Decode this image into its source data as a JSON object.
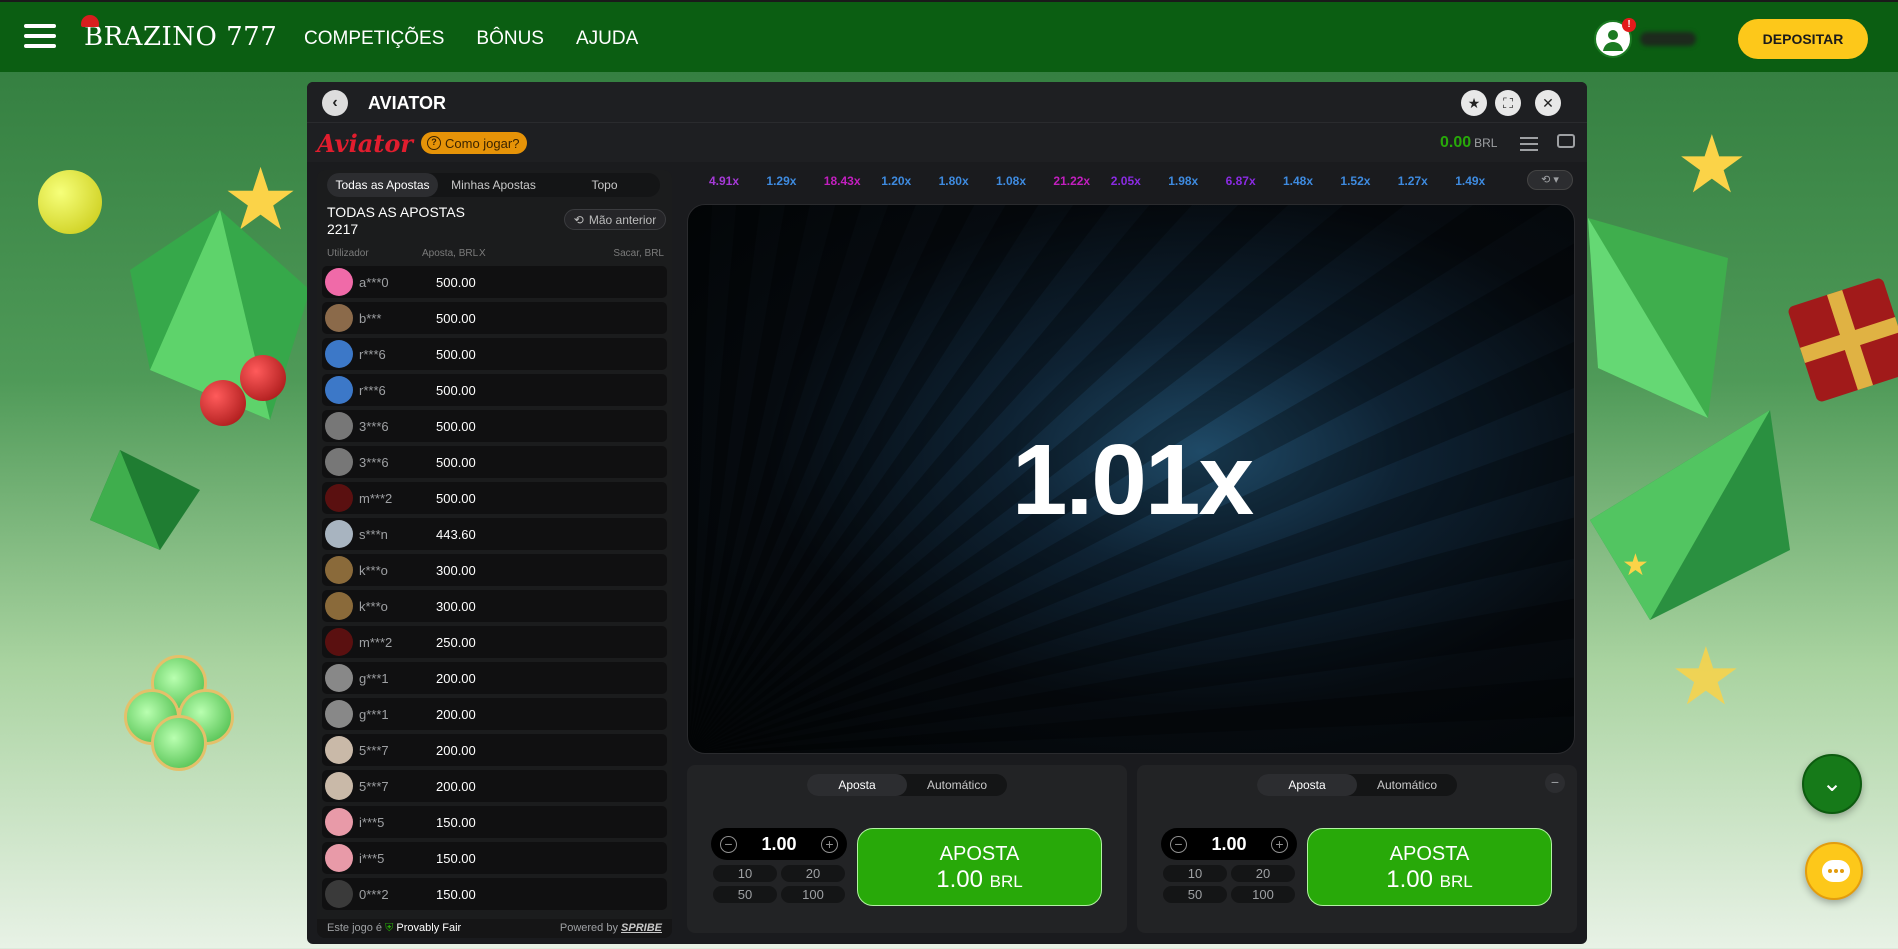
{
  "topbar": {
    "brand": "BRAZINO 777",
    "nav": [
      "COMPETIÇÕES",
      "BÔNUS",
      "AJUDA"
    ],
    "notification_badge": "!",
    "deposit_label": "DEPOSITAR"
  },
  "game": {
    "title": "AVIATOR",
    "logo": "Aviator",
    "how_to_play": "Como jogar?",
    "balance": "0.00",
    "currency": "BRL",
    "current_multiplier": "1.01x"
  },
  "bets": {
    "tabs": [
      "Todas as Apostas",
      "Minhas Apostas",
      "Topo"
    ],
    "all_bets_label": "TODAS AS APOSTAS",
    "total_count": "2217",
    "previous_hand": "Mão anterior",
    "columns": [
      "Utilizador",
      "Aposta, BRL",
      "X",
      "Sacar, BRL"
    ],
    "rows": [
      {
        "user": "a***0",
        "amount": "500.00"
      },
      {
        "user": "b***",
        "amount": "500.00"
      },
      {
        "user": "r***6",
        "amount": "500.00"
      },
      {
        "user": "r***6",
        "amount": "500.00"
      },
      {
        "user": "3***6",
        "amount": "500.00"
      },
      {
        "user": "3***6",
        "amount": "500.00"
      },
      {
        "user": "m***2",
        "amount": "500.00"
      },
      {
        "user": "s***n",
        "amount": "443.60"
      },
      {
        "user": "k***o",
        "amount": "300.00"
      },
      {
        "user": "k***o",
        "amount": "300.00"
      },
      {
        "user": "m***2",
        "amount": "250.00"
      },
      {
        "user": "g***1",
        "amount": "200.00"
      },
      {
        "user": "g***1",
        "amount": "200.00"
      },
      {
        "user": "5***7",
        "amount": "200.00"
      },
      {
        "user": "5***7",
        "amount": "200.00"
      },
      {
        "user": "i***5",
        "amount": "150.00"
      },
      {
        "user": "i***5",
        "amount": "150.00"
      },
      {
        "user": "0***2",
        "amount": "150.00"
      }
    ],
    "footer_left": "Este jogo é",
    "footer_pf": "Provably Fair",
    "footer_powered": "Powered by",
    "footer_brand": "SPRIBE"
  },
  "history_multipliers": [
    {
      "value": "4.91x",
      "color": "#a63ad8"
    },
    {
      "value": "1.29x",
      "color": "#3e8be0"
    },
    {
      "value": "18.43x",
      "color": "#c21fbf"
    },
    {
      "value": "1.20x",
      "color": "#3e8be0"
    },
    {
      "value": "1.80x",
      "color": "#3e8be0"
    },
    {
      "value": "1.08x",
      "color": "#3e8be0"
    },
    {
      "value": "21.22x",
      "color": "#c21fbf"
    },
    {
      "value": "2.05x",
      "color": "#8a2be2"
    },
    {
      "value": "1.98x",
      "color": "#3e8be0"
    },
    {
      "value": "6.87x",
      "color": "#8a2be2"
    },
    {
      "value": "1.48x",
      "color": "#3e8be0"
    },
    {
      "value": "1.52x",
      "color": "#3e8be0"
    },
    {
      "value": "1.27x",
      "color": "#3e8be0"
    },
    {
      "value": "1.49x",
      "color": "#3e8be0"
    }
  ],
  "bet_panels": [
    {
      "tabs": [
        "Aposta",
        "Automático"
      ],
      "stake": "1.00",
      "quick": [
        "10",
        "20",
        "50",
        "100"
      ],
      "button_label": "APOSTA",
      "button_amount": "1.00",
      "button_currency": "BRL"
    },
    {
      "tabs": [
        "Aposta",
        "Automático"
      ],
      "stake": "1.00",
      "quick": [
        "10",
        "20",
        "50",
        "100"
      ],
      "button_label": "APOSTA",
      "button_amount": "1.00",
      "button_currency": "BRL"
    }
  ],
  "colors": {
    "brand_green": "#0b5e12",
    "deposit_yellow": "#fdc81a",
    "bet_green": "#28a909",
    "aviator_red": "#e11d2e"
  }
}
